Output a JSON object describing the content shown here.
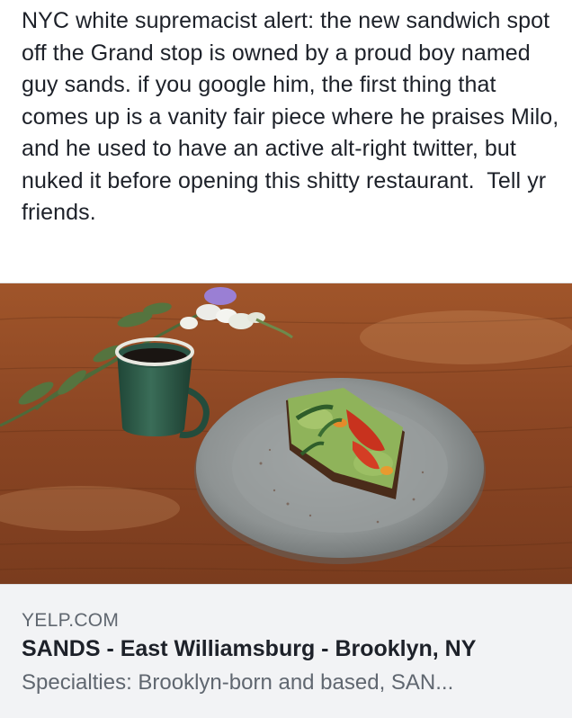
{
  "post": {
    "text": "NYC white supremacist alert: the new sandwich spot off the Grand stop is owned by a proud boy named guy sands. if you google him, the first thing that comes up is a vanity fair piece where he praises Milo, and he used to have an active alt-right twitter, but nuked it before opening this shitty restaurant.  Tell yr friends."
  },
  "link_preview": {
    "domain": "YELP.COM",
    "title": "SANDS - East Williamsburg - Brooklyn, NY",
    "description": "Specialties: Brooklyn-born and based, SAN..."
  },
  "image": {
    "subject": "avocado toast on pewter plate with green enamel mug and flowers on wooden table",
    "colors": {
      "table": "#8a4b26",
      "plate": "#8f9496",
      "mug": "#2f5e4c",
      "avocado": "#8fb35a",
      "pepper": "#c8321e"
    }
  }
}
